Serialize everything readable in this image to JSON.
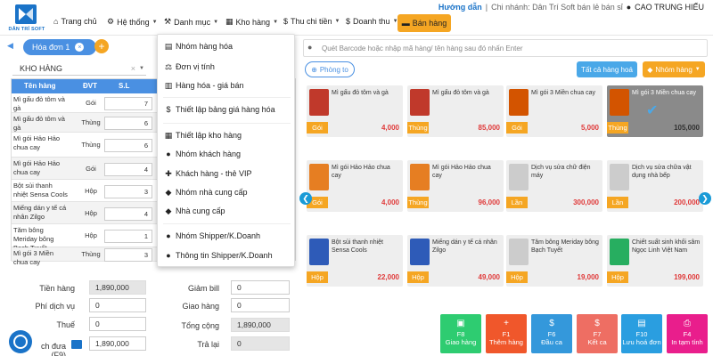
{
  "brand": {
    "logo_text": "DÂN TRÍ SOFT"
  },
  "nav": [
    {
      "label": "Trang chủ",
      "icon": "home-icon",
      "caret": false
    },
    {
      "label": "Hệ thống",
      "icon": "gear-icon",
      "caret": true
    },
    {
      "label": "Danh mục",
      "icon": "wrench-icon",
      "caret": true
    },
    {
      "label": "Kho hàng",
      "icon": "warehouse-icon",
      "caret": true
    },
    {
      "label": "Thu chi tiền",
      "icon": "dollar-icon",
      "caret": true
    },
    {
      "label": "Doanh thu",
      "icon": "dollar-icon",
      "caret": true
    }
  ],
  "sell_button": "Bán hàng",
  "header_right": {
    "guide": "Hướng dẫn",
    "separator": "|",
    "branch": "Chi nhánh: Dân Trí Soft bán lẻ bán sỉ",
    "user": "CAO TRUNG HIẾU"
  },
  "bill_tab": {
    "label": "Hóa đơn 1",
    "close": "×",
    "add": "+"
  },
  "warehouse": {
    "value": "KHO HÀNG",
    "clear": "×"
  },
  "table": {
    "columns": [
      "Tên hàng",
      "ĐVT",
      "S.L"
    ],
    "rows": [
      {
        "name": "Mì gấu đỏ tôm và gà",
        "unit": "Gói",
        "qty": "7"
      },
      {
        "name": "Mì gấu đỏ tôm và gà",
        "unit": "Thùng",
        "qty": "6"
      },
      {
        "name": "Mì gói Hảo Hảo chua cay",
        "unit": "Thùng",
        "qty": "6"
      },
      {
        "name": "Mì gói Hảo Hảo chua cay",
        "unit": "Gói",
        "qty": "4"
      },
      {
        "name": "Bột sủi thanh nhiệt Sensa Cools",
        "unit": "Hộp",
        "qty": "3"
      },
      {
        "name": "Miếng dán y tế cá nhân Zilgo",
        "unit": "Hộp",
        "qty": "4"
      },
      {
        "name": "Tăm bông Meriday bông Bạch Tuyết",
        "unit": "Hộp",
        "qty": "1"
      },
      {
        "name": "Mì gói 3 Miền chua cay",
        "unit": "Thùng",
        "qty": "3"
      }
    ],
    "remove": "×"
  },
  "totals": {
    "tien_hang_label": "Tiền hàng",
    "tien_hang": "1,890,000",
    "phi_dv_label": "Phí dịch vụ",
    "phi_dv": "0",
    "thue_label": "Thuế",
    "thue": "0",
    "dua_label": "ch đưa (F9)",
    "dua": "1,890,000",
    "giam_bill_label": "Giảm bill",
    "giam_bill": "0",
    "giao_hang_label": "Giao hàng",
    "giao_hang": "0",
    "tong_cong_label": "Tổng cộng",
    "tong_cong": "1,890,000",
    "tra_lai_label": "Trả lại",
    "tra_lai": "0"
  },
  "barcode": {
    "placeholder": "Quét Barcode hoặc nhập mã hàng/ tên hàng sau đó nhấn Enter"
  },
  "room_button": "Phòng to",
  "all_button": "Tất cả hàng hoá",
  "group_button": "Nhóm hàng",
  "products": [
    {
      "name": "Mì gấu đỏ tôm và gà",
      "unit": "Gói",
      "price": "4,000",
      "selected": false,
      "color": "#c0392b"
    },
    {
      "name": "Mì gấu đỏ tôm và gà",
      "unit": "Thùng",
      "price": "85,000",
      "selected": false,
      "color": "#c0392b"
    },
    {
      "name": "Mì gói 3 Miền chua cay",
      "unit": "Gói",
      "price": "5,000",
      "selected": false,
      "color": "#d35400"
    },
    {
      "name": "Mì gói 3 Miền chua cay",
      "unit": "Thùng",
      "price": "105,000",
      "selected": true,
      "color": "#d35400"
    },
    {
      "name": "Mì gói Hảo Hảo chua cay",
      "unit": "Gói",
      "price": "4,000",
      "selected": false,
      "color": "#e67e22"
    },
    {
      "name": "Mì gói Hảo Hảo chua cay",
      "unit": "Thùng",
      "price": "96,000",
      "selected": false,
      "color": "#e67e22"
    },
    {
      "name": "Dịch vụ sửa chữ điện máy",
      "unit": "Lần",
      "price": "300,000",
      "selected": false,
      "color": "#cccccc"
    },
    {
      "name": "Dịch vụ sửa chữa vật dụng nhà bếp",
      "unit": "Lần",
      "price": "200,000",
      "selected": false,
      "color": "#cccccc"
    },
    {
      "name": "Bột sủi thanh nhiệt Sensa Cools",
      "unit": "Hộp",
      "price": "22,000",
      "selected": false,
      "color": "#2e5bb8"
    },
    {
      "name": "Miếng dán y tế cá nhân Zilgo",
      "unit": "Hộp",
      "price": "49,000",
      "selected": false,
      "color": "#2e5bb8"
    },
    {
      "name": "Tăm bông Meriday bông Bạch Tuyết",
      "unit": "Hộp",
      "price": "19,000",
      "selected": false,
      "color": "#cccccc"
    },
    {
      "name": "Chiết suất sinh khối sâm Ngọc Linh Việt Nam",
      "unit": "Hộp",
      "price": "199,000",
      "selected": false,
      "color": "#27ae60"
    }
  ],
  "func_buttons": [
    {
      "key": "F8",
      "label": "Giao hàng",
      "color": "#2ecc71",
      "icon": "truck-icon",
      "glyph": "▣"
    },
    {
      "key": "F1",
      "label": "Thêm hàng",
      "color": "#f0572b",
      "icon": "plus-icon",
      "glyph": "+"
    },
    {
      "key": "F6",
      "label": "Đầu ca",
      "color": "#3498db",
      "icon": "dollar-icon",
      "glyph": "$"
    },
    {
      "key": "F7",
      "label": "Kết ca",
      "color": "#ee6e63",
      "icon": "dollar-icon",
      "glyph": "$"
    },
    {
      "key": "F10",
      "label": "Lưu hoá đơn",
      "color": "#2a9ee0",
      "icon": "save-icon",
      "glyph": "▤"
    },
    {
      "key": "F4",
      "label": "In tạm tính",
      "color": "#e91e8c",
      "icon": "print-icon",
      "glyph": "⎙"
    }
  ],
  "menu": [
    {
      "label": "Nhóm hàng hóa",
      "icon": "clipboard-icon",
      "glyph": "▤"
    },
    {
      "label": "Đơn vị tính",
      "icon": "scale-icon",
      "glyph": "⚖"
    },
    {
      "label": "Hàng hóa - giá bán",
      "icon": "barcode-icon",
      "glyph": "▥"
    },
    {
      "label": "Thiết lập bảng giá hàng hóa",
      "icon": "dollar-icon",
      "glyph": "$"
    },
    {
      "label": "Thiết lập kho hàng",
      "icon": "warehouse-icon",
      "glyph": "▦"
    },
    {
      "label": "Nhóm khách hàng",
      "icon": "users-icon",
      "glyph": "●"
    },
    {
      "label": "Khách hàng - thẻ VIP",
      "icon": "user-plus-icon",
      "glyph": "✚"
    },
    {
      "label": "Nhóm nhà cung cấp",
      "icon": "tag-icon",
      "glyph": "◆"
    },
    {
      "label": "Nhà cung cấp",
      "icon": "tag-icon",
      "glyph": "◆"
    },
    {
      "label": "Nhóm Shipper/K.Doanh",
      "icon": "group-icon",
      "glyph": "●"
    },
    {
      "label": "Thông tin Shipper/K.Doanh",
      "icon": "user-icon",
      "glyph": "●"
    }
  ]
}
